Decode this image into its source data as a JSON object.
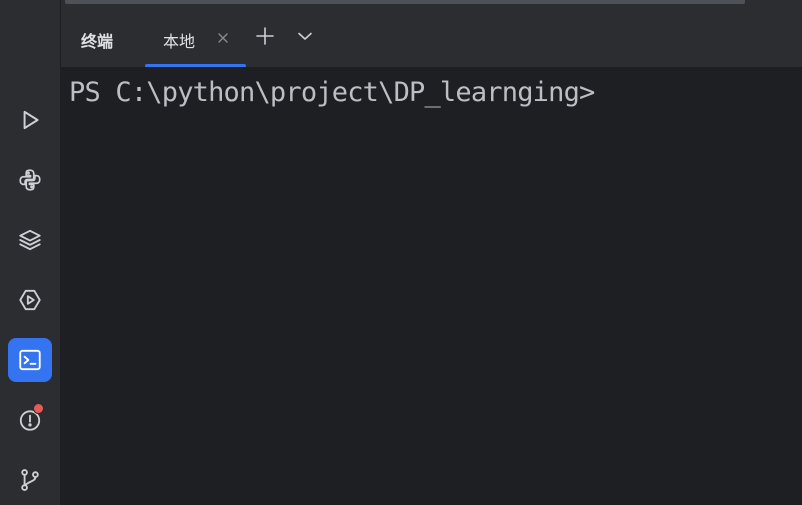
{
  "sidebar": {
    "items": [
      {
        "icon": "run-icon",
        "active": false
      },
      {
        "icon": "python-console-icon",
        "active": false
      },
      {
        "icon": "layers-icon",
        "active": false
      },
      {
        "icon": "services-icon",
        "active": false
      },
      {
        "icon": "terminal-icon",
        "active": true
      },
      {
        "icon": "problems-icon",
        "active": false,
        "has_badge": true
      },
      {
        "icon": "git-icon",
        "active": false
      }
    ]
  },
  "header": {
    "tool_title": "终端",
    "tabs": [
      {
        "label": "本地",
        "selected": true
      }
    ],
    "new_tab_icon": "plus-icon",
    "dropdown_icon": "chevron-down-icon"
  },
  "terminal": {
    "prompt": "PS C:\\python\\project\\DP_learnging>"
  },
  "colors": {
    "background": "#1e1f22",
    "panel": "#2b2d30",
    "accent": "#3574f0",
    "text": "#bcbec4",
    "badge": "#e55b56"
  }
}
